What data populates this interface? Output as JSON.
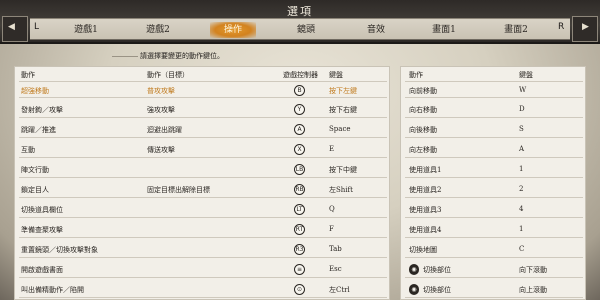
{
  "header": {
    "title": "選項",
    "prev_glyph": "◀",
    "next_glyph": "▶",
    "prev_key": "L",
    "next_key": "R",
    "tabs": [
      {
        "label": "遊戲1"
      },
      {
        "label": "遊戲2"
      },
      {
        "label": "操作"
      },
      {
        "label": "鏡頭"
      },
      {
        "label": "音效"
      },
      {
        "label": "畫面1"
      },
      {
        "label": "畫面2"
      }
    ],
    "active_tab": "操作"
  },
  "hint": "請選擇要變更的動作鍵位。",
  "left_panel": {
    "headers": {
      "action": "動作",
      "action_target": "動作（目標）",
      "controller": "遊戲控制器",
      "key": "鍵盤"
    },
    "rows": [
      {
        "action": "超強移動",
        "target": "普攻攻擊",
        "controller": "B",
        "key": "按下左鍵",
        "highlight": true
      },
      {
        "action": "發射鉤／攻擊",
        "target": "強攻攻擊",
        "controller": "Y",
        "key": "按下右鍵"
      },
      {
        "action": "跳躍／推進",
        "target": "迴避出跳躍",
        "controller": "A",
        "key": "Space"
      },
      {
        "action": "互動",
        "target": "傳送攻擊",
        "controller": "X",
        "key": "E"
      },
      {
        "action": "陣文行動",
        "target": "",
        "controller": "LB",
        "key": "按下中鍵"
      },
      {
        "action": "鎖定目人",
        "target": "固定目標出解除目標",
        "controller": "RB",
        "key": "左Shift"
      },
      {
        "action": "切換道具欄位",
        "target": "",
        "controller": "LT",
        "key": "Q"
      },
      {
        "action": "準備查聚攻擊",
        "target": "",
        "controller": "RT",
        "key": "F"
      },
      {
        "action": "重置鏡頭／切換攻擊對象",
        "target": "",
        "controller": "R3",
        "key": "Tab"
      },
      {
        "action": "開啟遊戲書面",
        "target": "",
        "controller": "≡",
        "key": "Esc"
      },
      {
        "action": "叫出備精動作／陷開",
        "target": "",
        "controller": "⊙",
        "key": "左Ctrl"
      }
    ]
  },
  "right_panel": {
    "headers": {
      "action": "動作",
      "key": "鍵盤"
    },
    "rows": [
      {
        "action": "向前移動",
        "key": "W",
        "mouse": false
      },
      {
        "action": "向右移動",
        "key": "D",
        "mouse": false
      },
      {
        "action": "向後移動",
        "key": "S",
        "mouse": false
      },
      {
        "action": "向左移動",
        "key": "A",
        "mouse": false
      },
      {
        "action": "使用道具1",
        "key": "1",
        "mouse": false
      },
      {
        "action": "使用道具2",
        "key": "2",
        "mouse": false
      },
      {
        "action": "使用道具3",
        "key": "4",
        "mouse": false
      },
      {
        "action": "使用道具4",
        "key": "1",
        "mouse": false
      },
      {
        "action": "切換地圖",
        "key": "C",
        "mouse": false
      },
      {
        "action": "切換部位",
        "key": "向下滾動",
        "mouse": true
      },
      {
        "action": "切換部位",
        "key": "向上滾動",
        "mouse": true
      }
    ]
  }
}
